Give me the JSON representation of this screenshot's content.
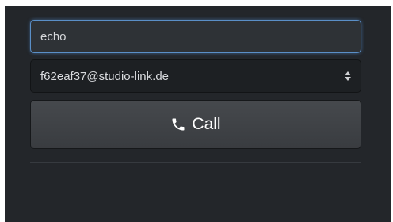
{
  "call_form": {
    "input_value": "echo",
    "account": "f62eaf37@studio-link.de",
    "call_label": "Call"
  }
}
